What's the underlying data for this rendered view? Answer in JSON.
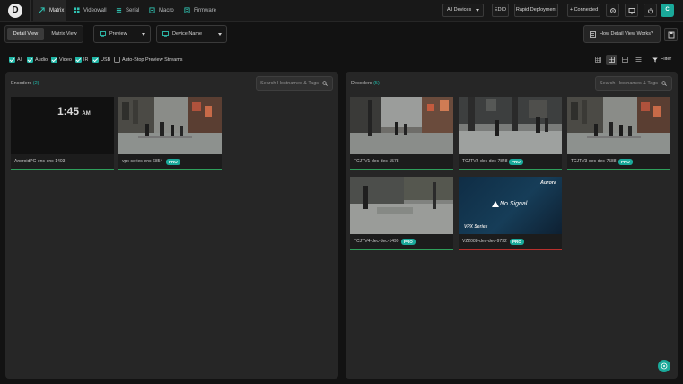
{
  "nav": {
    "logo": "D",
    "tabs": [
      {
        "label": "Matrix",
        "icon": "matrix-icon",
        "active": true
      },
      {
        "label": "Videowall",
        "icon": "videowall-icon",
        "active": false
      },
      {
        "label": "Serial",
        "icon": "serial-icon",
        "active": false
      },
      {
        "label": "Macro",
        "icon": "macro-icon",
        "active": false
      },
      {
        "label": "Firmware",
        "icon": "firmware-icon",
        "active": false
      }
    ],
    "device_filter": "All Devices",
    "edid": "EDID",
    "rapid": "Rapid Deployment",
    "connected": "+ Connected",
    "avatar": "C"
  },
  "toolbar": {
    "detail_view": "Detail View",
    "matrix_view": "Matrix View",
    "preview": "Preview",
    "device_name": "Device Name",
    "how_btn": "How Detail View Works?"
  },
  "filters": [
    {
      "label": "All",
      "checked": true
    },
    {
      "label": "Audio",
      "checked": true
    },
    {
      "label": "Video",
      "checked": true
    },
    {
      "label": "IR",
      "checked": true
    },
    {
      "label": "USB",
      "checked": true
    },
    {
      "label": "Auto-Stop Preview Streams",
      "checked": false
    }
  ],
  "filter_button": "Filter",
  "encoders": {
    "title": "Encoders",
    "count": "(2)",
    "search_placeholder": "Search Hostnames & Tags",
    "cards": [
      {
        "name": "AndroidPC-enc-enc-1403",
        "badge": "",
        "clock": "1:45",
        "ampm": "AM"
      },
      {
        "name": "vpx-series-enc-6854",
        "badge": "PRO"
      }
    ]
  },
  "decoders": {
    "title": "Decoders",
    "count": "(5)",
    "search_placeholder": "Search Hostnames & Tags",
    "cards": [
      {
        "name": "TCJTV1-dec-dec-1578",
        "badge": ""
      },
      {
        "name": "TCJTV2-dec-dec-7848",
        "badge": "PRO"
      },
      {
        "name": "TCJTV3-dec-dec-7588",
        "badge": "PRO"
      },
      {
        "name": "TCJTV4-dec-dec-1499",
        "badge": "PRO"
      },
      {
        "name": "VZ2088-dec-dec-9732",
        "badge": "PRO",
        "no_signal": "No Signal",
        "brand": "Aurora",
        "series": "VPX Series"
      }
    ]
  }
}
